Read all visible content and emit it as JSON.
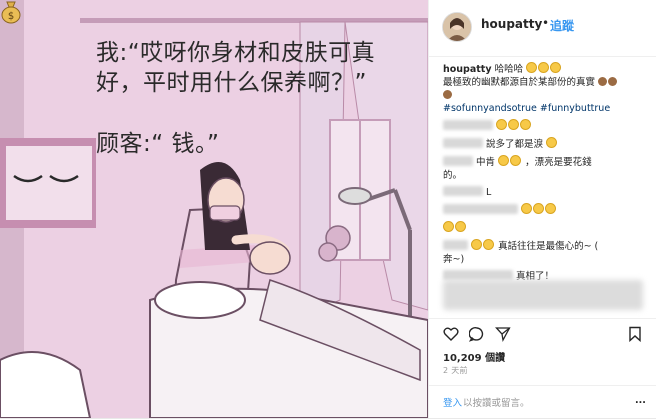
{
  "image": {
    "caption_line1": "我:“哎呀你身材和皮肤可真",
    "caption_line2": "好，平时用什么保养啊？”",
    "caption_line3": "顾客:“ 钱。”",
    "moneybag_icon": "money-bag-icon"
  },
  "post": {
    "username": "houpatty",
    "separator": "•",
    "follow_label": "追蹤"
  },
  "comments": {
    "owner_username": "houpatty",
    "owner_text": "哈哈哈",
    "owner_line2": "最極致的幽默都源自於某部份的真實",
    "hashtags": "#sofunnyandsotrue #funnybuttrue",
    "c2_text": "說多了都是淚",
    "c3_text": "中肯",
    "c3_text2": "，漂亮是要花錢",
    "c3_text3": "的。",
    "c4_text": "L",
    "c6_text": "真話往往是最傷心的~ (",
    "c6_text2": "奔~)",
    "c7_text": "真相了！"
  },
  "stats": {
    "likes": "10,209 個讚",
    "time_ago": "2 天前"
  },
  "login": {
    "login_label": "登入",
    "login_suffix": "以按讚或留言。",
    "more_dots": "..."
  },
  "colors": {
    "accent": "#3897f0",
    "hashtag": "#003569",
    "image_bg": "#e8c6dc"
  }
}
